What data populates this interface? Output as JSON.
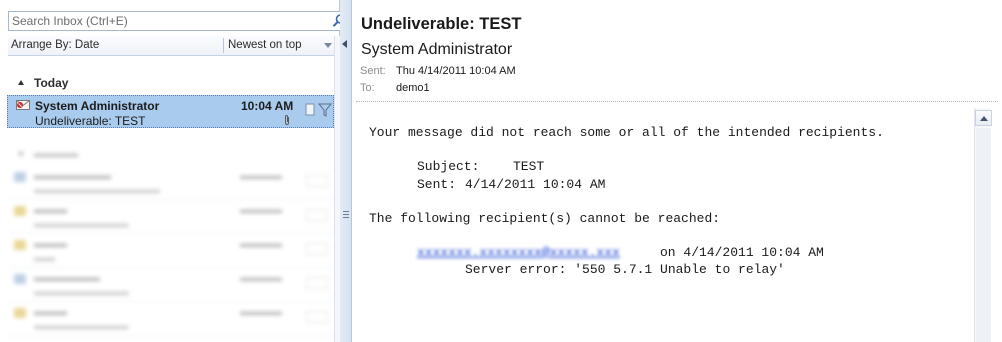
{
  "search": {
    "placeholder": "Search Inbox (Ctrl+E)"
  },
  "arrange": {
    "label": "Arrange By: Date",
    "sort_label": "Newest on top"
  },
  "groups": {
    "today": "Today"
  },
  "selected_message": {
    "from": "System Administrator",
    "time": "10:04 AM",
    "subject": "Undeliverable: TEST"
  },
  "reading_pane": {
    "subject": "Undeliverable: TEST",
    "from": "System Administrator",
    "sent_label": "Sent:",
    "sent_value": "Thu 4/14/2011 10:04 AM",
    "to_label": "To:",
    "to_value": "demo1",
    "body": {
      "line1": "Your message did not reach some or all of the intended recipients.",
      "subject_label": "Subject:",
      "subject_value": "TEST",
      "sent_label": "Sent:",
      "sent_value": "4/14/2011 10:04 AM",
      "recipients_line": "The following recipient(s) cannot be reached:",
      "recipient_after": "on 4/14/2011 10:04 AM",
      "server_error": "Server error: '550 5.7.1 Unable to relay'"
    }
  },
  "colors": {
    "selected_row": "#a9ccee",
    "link": "#1640d0",
    "pane_border": "#b9c8dc"
  },
  "icons": {
    "search": "search-icon",
    "envelope": "envelope-icon",
    "attachment": "paperclip-icon",
    "flag": "flag-icon",
    "category": "category-icon"
  }
}
